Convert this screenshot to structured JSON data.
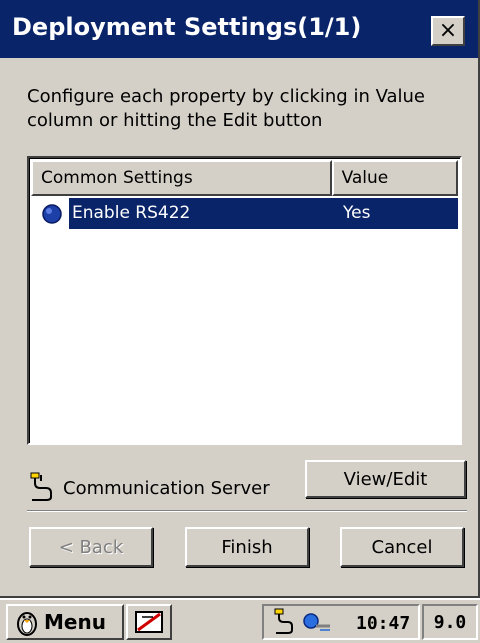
{
  "window": {
    "title": "Deployment Settings(1/1)",
    "close_glyph": "×",
    "instruction": "Configure each property by clicking in Value column or hitting the Edit button"
  },
  "list": {
    "columns": [
      "Common Settings",
      "Value"
    ],
    "rows": [
      {
        "name": "Enable RS422",
        "value": "Yes",
        "icon": "blue-dot-icon",
        "selected": true
      }
    ]
  },
  "server": {
    "label": "Communication Server",
    "icon": "serial-cable-icon"
  },
  "buttons": {
    "view_edit": "View/Edit",
    "back": "< Back",
    "finish": "Finish",
    "cancel": "Cancel"
  },
  "taskbar": {
    "start_label": "Menu",
    "clock": "10:47",
    "extra": "9.0"
  },
  "colors": {
    "titlebar": "#0a246a",
    "selection": "#0a246a",
    "face": "#d4d0c8"
  }
}
